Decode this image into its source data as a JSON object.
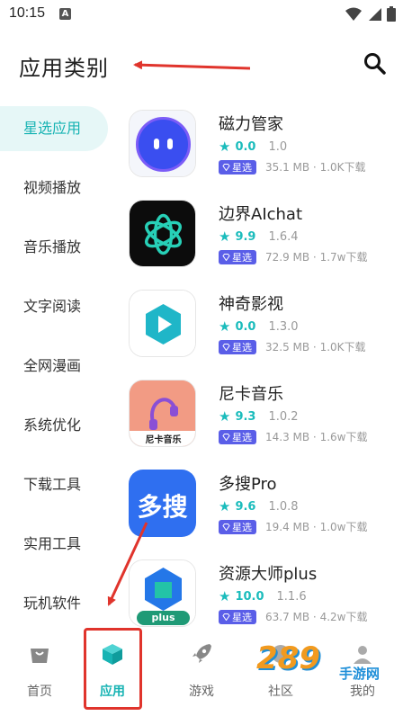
{
  "status_bar": {
    "time": "10:15",
    "notification_letter": "A"
  },
  "header": {
    "title": "应用类别"
  },
  "sidebar": {
    "items": [
      {
        "label": "星选应用",
        "active": true
      },
      {
        "label": "视频播放",
        "active": false
      },
      {
        "label": "音乐播放",
        "active": false
      },
      {
        "label": "文字阅读",
        "active": false
      },
      {
        "label": "全网漫画",
        "active": false
      },
      {
        "label": "系统优化",
        "active": false
      },
      {
        "label": "下载工具",
        "active": false
      },
      {
        "label": "实用工具",
        "active": false
      },
      {
        "label": "玩机软件",
        "active": false
      }
    ]
  },
  "apps": [
    {
      "name": "磁力管家",
      "score": "0.0",
      "version": "1.0",
      "badge": "星选",
      "meta": "35.1 MB · 1.0K下载",
      "icon": "magnet-manager-icon"
    },
    {
      "name": "边界AIchat",
      "score": "9.9",
      "version": "1.6.4",
      "badge": "星选",
      "meta": "72.9 MB · 1.7w下载",
      "icon": "boundary-aichat-icon"
    },
    {
      "name": "神奇影视",
      "score": "0.0",
      "version": "1.3.0",
      "badge": "星选",
      "meta": "32.5 MB · 1.0K下载",
      "icon": "play-video-icon"
    },
    {
      "name": "尼卡音乐",
      "score": "9.3",
      "version": "1.0.2",
      "badge": "星选",
      "meta": "14.3 MB · 1.6w下载",
      "icon": "headphones-icon",
      "icon_caption": "尼卡音乐"
    },
    {
      "name": "多搜Pro",
      "score": "9.6",
      "version": "1.0.8",
      "badge": "星选",
      "meta": "19.4 MB · 1.0w下载",
      "icon": "duosou-icon",
      "icon_caption": "多搜"
    },
    {
      "name": "资源大师plus",
      "score": "10.0",
      "version": "1.1.6",
      "badge": "星选",
      "meta": "63.7 MB · 4.2w下载",
      "icon": "resource-master-icon",
      "icon_caption": "plus"
    }
  ],
  "bottom_nav": [
    {
      "label": "首页",
      "icon": "home-bag-icon",
      "active": false
    },
    {
      "label": "应用",
      "icon": "app-cube-icon",
      "active": true
    },
    {
      "label": "游戏",
      "icon": "rocket-icon",
      "active": false
    },
    {
      "label": "社区",
      "icon": "community-icon",
      "active": false
    },
    {
      "label": "我的",
      "icon": "profile-icon",
      "active": false
    }
  ],
  "watermark": {
    "text": "手游网",
    "logo": "289"
  },
  "colors": {
    "accent": "#17b3b3",
    "badge": "#5a5ee8",
    "annotation": "#e0342c"
  }
}
